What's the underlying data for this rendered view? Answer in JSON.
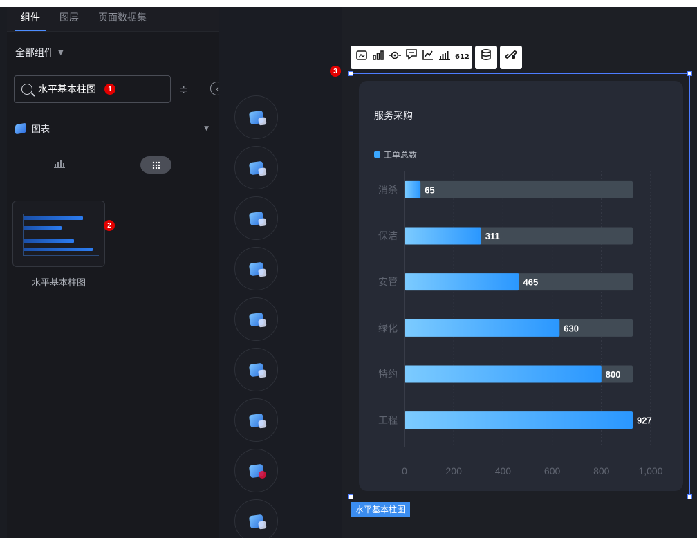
{
  "left_panel": {
    "tabs": [
      "组件",
      "图层",
      "页面数据集"
    ],
    "active_tab": 0,
    "filter_label": "全部组件",
    "search": {
      "value": "水平基本柱图",
      "badge": "1"
    },
    "category": {
      "label": "图表"
    },
    "component": {
      "label": "水平基本柱图",
      "badge": "2"
    }
  },
  "icon_column": {
    "icons": [
      "image-chart-icon",
      "video-icon",
      "text-icon",
      "media-icon",
      "gauge-icon",
      "more-icon",
      "direction-icon",
      "record-icon",
      "tools-icon"
    ]
  },
  "toolbar": {
    "group1": [
      "image-chart-icon",
      "bar-chart-icon",
      "target-icon",
      "comment-icon",
      "line-chart-icon",
      "bars-icon",
      "number-icon"
    ],
    "number_label": "612",
    "group2": [
      "database-icon"
    ],
    "group3": [
      "link-icon"
    ]
  },
  "selection": {
    "badge": "3",
    "label": "水平基本柱图"
  },
  "chart_data": {
    "type": "bar",
    "orientation": "horizontal",
    "title": "服务采购",
    "legend": [
      "工单总数"
    ],
    "legend_position": "top-left",
    "categories": [
      "消杀",
      "保洁",
      "安管",
      "绿化",
      "特约",
      "工程"
    ],
    "series": [
      {
        "name": "工单总数",
        "values": [
          65,
          311,
          465,
          630,
          800,
          927
        ]
      }
    ],
    "background_max": 927,
    "xlim": [
      0,
      1000
    ],
    "x_ticks": [
      "0",
      "200",
      "400",
      "600",
      "800",
      "1,000"
    ],
    "grid": true,
    "colors": {
      "bar_start": "#7ccbff",
      "bar_end": "#2a97ff",
      "track": "#414b55",
      "label": "#ffffff",
      "axis_label": "#5f6470"
    }
  }
}
